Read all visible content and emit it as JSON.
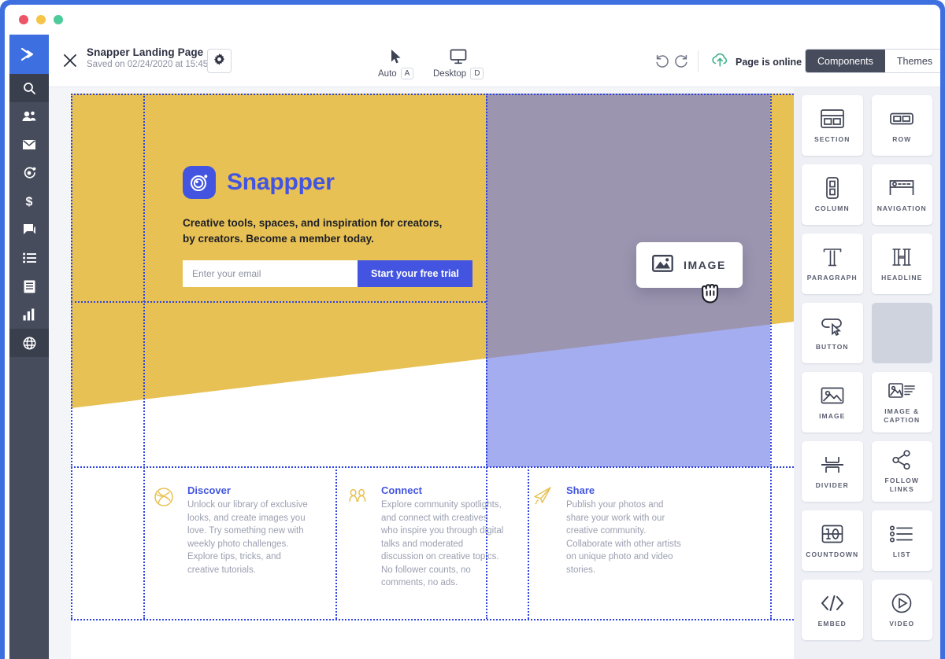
{
  "window": {
    "traffic_lights": [
      "close",
      "minimize",
      "maximize"
    ],
    "frame_color": "#3d6fe0"
  },
  "rail": {
    "logo_icon": "double-chevron-logo",
    "items": [
      {
        "icon": "search-icon",
        "name": "search",
        "active": true
      },
      {
        "icon": "contacts-icon",
        "name": "contacts",
        "active": false
      },
      {
        "icon": "envelope-icon",
        "name": "email",
        "active": false
      },
      {
        "icon": "automation-target-icon",
        "name": "automations",
        "active": false
      },
      {
        "icon": "dollar-icon",
        "name": "deals",
        "active": false
      },
      {
        "icon": "chat-icon",
        "name": "conversations",
        "active": false
      },
      {
        "icon": "list-icon",
        "name": "lists",
        "active": false
      },
      {
        "icon": "document-icon",
        "name": "pages",
        "active": false
      },
      {
        "icon": "bar-chart-icon",
        "name": "reports",
        "active": false
      },
      {
        "icon": "globe-icon",
        "name": "website",
        "active": true
      }
    ]
  },
  "toolbar": {
    "close_icon": "close-icon",
    "title": "Snapper Landing Page",
    "saved_label": "Saved on 02/24/2020 at 15:45",
    "settings_icon": "gear-icon",
    "view_modes": [
      {
        "label": "Auto",
        "key": "A",
        "icon": "cursor-arrow-icon"
      },
      {
        "label": "Desktop",
        "key": "D",
        "icon": "monitor-icon"
      }
    ],
    "undo_icon": "undo-icon",
    "redo_icon": "redo-icon",
    "status_icon": "cloud-upload-icon",
    "status_color": "#3cb08a",
    "status_text": "Page is online",
    "tabs": [
      {
        "label": "Components",
        "active": true
      },
      {
        "label": "Themes",
        "active": false
      }
    ]
  },
  "canvas": {
    "hero": {
      "background_color": "#e8c154",
      "brand_logo_icon": "camera-aperture-icon",
      "brand_name": "Snappper",
      "brand_color": "#4355e0",
      "tagline": "Creative tools, spaces, and inspiration for creators, by creators. Become a member today.",
      "email_placeholder": "Enter your email",
      "email_value": "",
      "cta_label": "Start your free trial",
      "cta_color": "#4355e0"
    },
    "phone": {
      "mockup_color": "#7b87ea",
      "dropzone_highlight": "rgba(110,123,232,0.62)"
    },
    "drag_chip": {
      "label": "IMAGE",
      "icon": "image-icon",
      "cursor": "grabbing-hand-cursor"
    },
    "features": [
      {
        "icon": "globe-sphere-icon",
        "title": "Discover",
        "body": "Unlock our library of exclusive looks, and create images you love. Try something new with weekly photo challenges. Explore tips, tricks, and creative tutorials."
      },
      {
        "icon": "people-group-icon",
        "title": "Connect",
        "body": "Explore community spotlights, and connect with creatives who inspire you through digital talks and moderated discussion on creative topics. No follower counts, no comments, no ads."
      },
      {
        "icon": "paper-plane-icon",
        "title": "Share",
        "body": "Publish your photos and share your work with our creative community. Collaborate with other artists on unique photo and video stories."
      }
    ]
  },
  "components": [
    {
      "label": "SECTION",
      "icon": "section-icon",
      "empty": false
    },
    {
      "label": "ROW",
      "icon": "row-icon",
      "empty": false
    },
    {
      "label": "COLUMN",
      "icon": "column-icon",
      "empty": false
    },
    {
      "label": "NAVIGATION",
      "icon": "navigation-icon",
      "empty": false
    },
    {
      "label": "PARAGRAPH",
      "icon": "paragraph-t-icon",
      "empty": false
    },
    {
      "label": "HEADLINE",
      "icon": "headline-h-icon",
      "empty": false
    },
    {
      "label": "BUTTON",
      "icon": "button-icon",
      "empty": false
    },
    {
      "label": "",
      "icon": "empty-slot",
      "empty": true
    },
    {
      "label": "IMAGE",
      "icon": "image-icon",
      "empty": false
    },
    {
      "label": "IMAGE & CAPTION",
      "icon": "image-caption-icon",
      "empty": false
    },
    {
      "label": "DIVIDER",
      "icon": "divider-icon",
      "empty": false
    },
    {
      "label": "FOLLOW LINKS",
      "icon": "share-nodes-icon",
      "empty": false
    },
    {
      "label": "COUNTDOWN",
      "icon": "countdown-icon",
      "empty": false
    },
    {
      "label": "LIST",
      "icon": "list-bullets-icon",
      "empty": false
    },
    {
      "label": "EMBED",
      "icon": "code-brackets-icon",
      "empty": false
    },
    {
      "label": "VIDEO",
      "icon": "play-circle-icon",
      "empty": false
    }
  ]
}
